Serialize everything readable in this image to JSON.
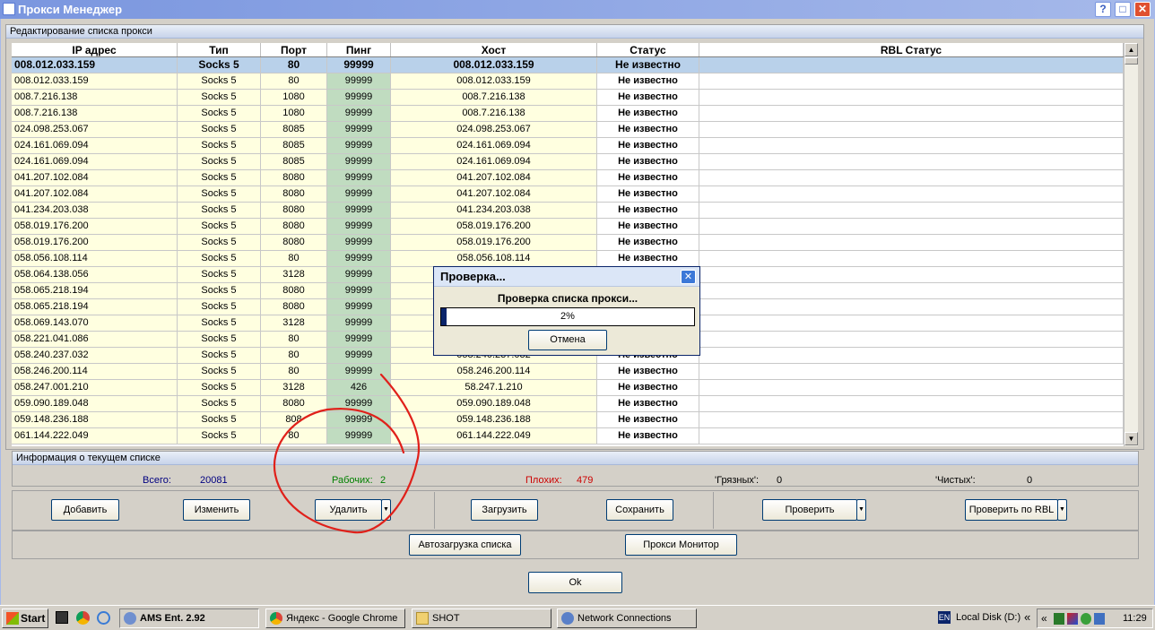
{
  "window": {
    "title": "Прокси Менеджер",
    "help": "?",
    "maximize": "□",
    "close": "✕"
  },
  "grid_group": {
    "title": "Редактирование списка прокси"
  },
  "columns": [
    "IP адрес",
    "Тип",
    "Порт",
    "Пинг",
    "Хост",
    "Статус",
    "RBL Статус"
  ],
  "rows": [
    [
      "008.012.033.159",
      "Socks 5",
      "80",
      "99999",
      "008.012.033.159",
      "Не известно",
      ""
    ],
    [
      "008.012.033.159",
      "Socks 5",
      "80",
      "99999",
      "008.012.033.159",
      "Не известно",
      ""
    ],
    [
      "008.7.216.138",
      "Socks 5",
      "1080",
      "99999",
      "008.7.216.138",
      "Не известно",
      ""
    ],
    [
      "008.7.216.138",
      "Socks 5",
      "1080",
      "99999",
      "008.7.216.138",
      "Не известно",
      ""
    ],
    [
      "024.098.253.067",
      "Socks 5",
      "8085",
      "99999",
      "024.098.253.067",
      "Не известно",
      ""
    ],
    [
      "024.161.069.094",
      "Socks 5",
      "8085",
      "99999",
      "024.161.069.094",
      "Не известно",
      ""
    ],
    [
      "024.161.069.094",
      "Socks 5",
      "8085",
      "99999",
      "024.161.069.094",
      "Не известно",
      ""
    ],
    [
      "041.207.102.084",
      "Socks 5",
      "8080",
      "99999",
      "041.207.102.084",
      "Не известно",
      ""
    ],
    [
      "041.207.102.084",
      "Socks 5",
      "8080",
      "99999",
      "041.207.102.084",
      "Не известно",
      ""
    ],
    [
      "041.234.203.038",
      "Socks 5",
      "8080",
      "99999",
      "041.234.203.038",
      "Не известно",
      ""
    ],
    [
      "058.019.176.200",
      "Socks 5",
      "8080",
      "99999",
      "058.019.176.200",
      "Не известно",
      ""
    ],
    [
      "058.019.176.200",
      "Socks 5",
      "8080",
      "99999",
      "058.019.176.200",
      "Не известно",
      ""
    ],
    [
      "058.056.108.114",
      "Socks 5",
      "80",
      "99999",
      "058.056.108.114",
      "Не известно",
      ""
    ],
    [
      "058.064.138.056",
      "Socks 5",
      "3128",
      "99999",
      "",
      "",
      ""
    ],
    [
      "058.065.218.194",
      "Socks 5",
      "8080",
      "99999",
      "",
      "",
      ""
    ],
    [
      "058.065.218.194",
      "Socks 5",
      "8080",
      "99999",
      "",
      "",
      ""
    ],
    [
      "058.069.143.070",
      "Socks 5",
      "3128",
      "99999",
      "",
      "",
      ""
    ],
    [
      "058.221.041.086",
      "Socks 5",
      "80",
      "99999",
      "",
      "",
      ""
    ],
    [
      "058.240.237.032",
      "Socks 5",
      "80",
      "99999",
      "058.240.237.032",
      "Не известно",
      ""
    ],
    [
      "058.246.200.114",
      "Socks 5",
      "80",
      "99999",
      "058.246.200.114",
      "Не известно",
      ""
    ],
    [
      "058.247.001.210",
      "Socks 5",
      "3128",
      "426",
      "58.247.1.210",
      "Не известно",
      ""
    ],
    [
      "059.090.189.048",
      "Socks 5",
      "8080",
      "99999",
      "059.090.189.048",
      "Не известно",
      ""
    ],
    [
      "059.148.236.188",
      "Socks 5",
      "808",
      "99999",
      "059.148.236.188",
      "Не известно",
      ""
    ],
    [
      "061.144.222.049",
      "Socks 5",
      "80",
      "99999",
      "061.144.222.049",
      "Не известно",
      ""
    ]
  ],
  "info": {
    "title": "Информация о текущем списке",
    "total_label": "Всего:",
    "total": "20081",
    "working_label": "Рабочих:",
    "working": "2",
    "bad_label": "Плохих:",
    "bad": "479",
    "dirty_label": "'Грязных':",
    "dirty": "0",
    "clean_label": "'Чистых':",
    "clean": "0"
  },
  "buttons": {
    "add": "Добавить",
    "edit": "Изменить",
    "delete": "Удалить",
    "load": "Загрузить",
    "save": "Сохранить",
    "check": "Проверить",
    "check_rbl": "Проверить по RBL",
    "autoload": "Автозагрузка списка",
    "monitor": "Прокси Монитор",
    "ok": "Ok"
  },
  "dialog": {
    "title": "Проверка...",
    "message": "Проверка списка прокси...",
    "progress_text": "2%",
    "progress": 0.02,
    "cancel": "Отмена",
    "close": "✕"
  },
  "taskbar": {
    "start": "Start",
    "tasks": [
      "AMS Ent. 2.92",
      "Яндекс - Google Chrome",
      "SHOT",
      "Network Connections"
    ],
    "lang": "EN",
    "disk": "Local Disk (D:)",
    "chevron": "«",
    "clock": "11:29"
  },
  "colors": {
    "accent": "#7a96df",
    "annotation": "#e0201a",
    "working": "#008000",
    "bad": "#cc0000",
    "total": "#000080"
  }
}
